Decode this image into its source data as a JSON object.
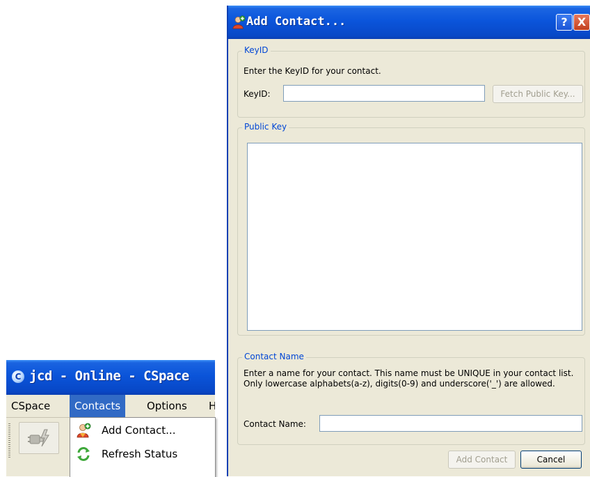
{
  "main_window": {
    "title": "jcd - Online - CSpace",
    "app_icon_glyph": "C",
    "menu": [
      {
        "label": "CSpace",
        "active": false
      },
      {
        "label": "Contacts",
        "active": true
      },
      {
        "label": "Options",
        "active": false
      },
      {
        "label": "H",
        "active": false
      }
    ]
  },
  "contacts_menu": {
    "items": [
      {
        "label": "Add Contact...",
        "icon": "add-contact-icon"
      },
      {
        "label": "Refresh Status",
        "icon": "refresh-icon"
      }
    ]
  },
  "dialog": {
    "title": "Add Contact...",
    "help_label": "?",
    "close_label": "X",
    "keyid_group": {
      "legend": "KeyID",
      "instruction": "Enter the KeyID for your contact.",
      "field_label": "KeyID:",
      "field_value": "",
      "fetch_button": "Fetch Public Key..."
    },
    "public_key_group": {
      "legend": "Public Key",
      "value": ""
    },
    "contact_name_group": {
      "legend": "Contact Name",
      "instruction": "Enter a name for your contact. This name must be UNIQUE in your contact list. Only lowercase alphabets(a-z), digits(0-9) and underscore('_') are allowed.",
      "field_label": "Contact Name:",
      "field_value": ""
    },
    "add_button": "Add Contact",
    "cancel_button": "Cancel"
  },
  "colors": {
    "titlebar_blue": "#0a54d9",
    "menu_highlight": "#316ac5",
    "group_legend": "#0046d5",
    "dialog_bg": "#ece9d8"
  }
}
